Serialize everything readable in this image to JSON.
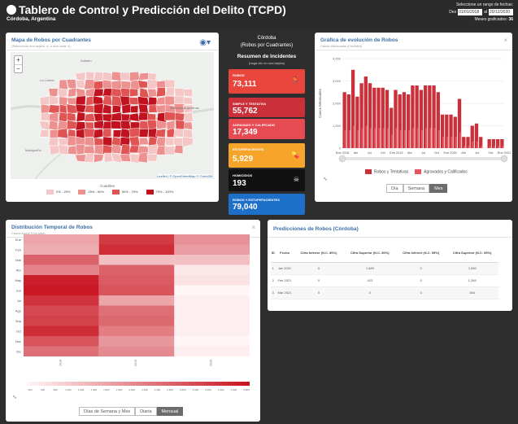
{
  "header": {
    "title": "Tablero de Control y Predicción del Delito (TCPD)",
    "subtitle": "Córdoba, Argentina",
    "date_prompt": "Seleccione un rango de fechas:",
    "date_from_label": "Des",
    "date_from": "01/01/2018",
    "date_to_label": "al",
    "date_to": "20/12/2020",
    "months_label": "Meses graficados:",
    "months_value": "36"
  },
  "map_card": {
    "title": "Mapa de Robos por Cuadrantes",
    "subtitle": "(Seleccione una región, ó, a una vista: 4)",
    "zoom_in": "+",
    "zoom_out": "−",
    "places": [
      "Kabalín",
      "La Calera",
      "Malagueño",
      "Malvinas Argentinas"
    ],
    "attribution": "Leaflet | © OpenStreetMap © CartoDB",
    "legend_title": "Cuartiles",
    "legend": [
      {
        "label": "0% - 25%",
        "color": "#f5c6c6"
      },
      {
        "label": "25% - 50%",
        "color": "#ec9090"
      },
      {
        "label": "50% - 75%",
        "color": "#e05454"
      },
      {
        "label": "75% - 100%",
        "color": "#c1121f"
      }
    ]
  },
  "center": {
    "city": "Córdoba",
    "city_sub": "(Robos por Cuadrantes)",
    "summary_title": "Resumen de Incidentes",
    "summary_sub": "(haga clic en una tarjeta)",
    "kpis": [
      {
        "label": "ROBOS",
        "value": "73,111",
        "color": "#e8453c",
        "icon": "🏃"
      },
      {
        "label": "SIMPLE Y TENTATIVA",
        "value": "55,762",
        "color": "#c9303a",
        "icon": ""
      },
      {
        "label": "AGRAVADO Y CALIFICADO",
        "value": "17,349",
        "color": "#e64a53",
        "icon": ""
      },
      {
        "label": "ESTUPEFACIENTES",
        "value": "5,929",
        "color": "#f7a42a",
        "icon": "💊"
      },
      {
        "label": "HOMICIDIOS",
        "value": "193",
        "color": "#111111",
        "icon": "☠"
      },
      {
        "label": "ROBOS Y ESTUPEFACIENTES",
        "value": "79,040",
        "color": "#1e6fc8",
        "icon": ""
      }
    ]
  },
  "evolution_card": {
    "title": "Gráfica de evolución de Robos",
    "subtitle": "Casos Mensuales (Córdoba)",
    "ylabel": "Casos Mensuales",
    "legend": [
      {
        "label": "Robos y Tentativas",
        "color": "#c9303a"
      },
      {
        "label": "Agravados y Calificados",
        "color": "#e85562"
      }
    ],
    "buttons": [
      "Día",
      "Semana",
      "Mes"
    ],
    "active_button": "Mes"
  },
  "heatmap_card": {
    "title": "Distribución Temporal de Robos",
    "subtitle": "Casos Anual (Córdoba)",
    "buttons": [
      "Días de Semana y Mes",
      "Diaria",
      "Mensual"
    ],
    "active_button": "Mensual",
    "rows": [
      "Ene",
      "Feb",
      "Mar",
      "Abr",
      "May",
      "Jun",
      "Jul",
      "Ago",
      "Sep",
      "Oct",
      "Nov",
      "Dic"
    ],
    "cols": [
      "2018",
      "2019",
      "2020"
    ],
    "scale_ticks": [
      "400",
      "600",
      "800",
      "1,000",
      "1,200",
      "1,400",
      "1,600",
      "1,800",
      "2,000",
      "2,200",
      "2,400",
      "2,600",
      "2,800",
      "3,000",
      "3,200",
      "3,400",
      "3,600",
      "3,800"
    ]
  },
  "prediction_card": {
    "title": "Predicciones de Robos (Córdoba)",
    "columns": [
      "ID",
      "Fecha",
      "Cifra Inferior (N.C. 80%)",
      "Cifra Superior (N.C. 80%)",
      "Cifra Inferior (N.C. 95%)",
      "Cifra Superior (N.C. 95%)"
    ],
    "rows": [
      [
        "1",
        "Jan 2021",
        "0",
        "1,689",
        "0",
        "2,536"
      ],
      [
        "2",
        "Feb 2021",
        "0",
        "423",
        "0",
        "1,265"
      ],
      [
        "3",
        "Mar 2021",
        "0",
        "0",
        "0",
        "364"
      ]
    ]
  },
  "chart_data": [
    {
      "type": "bar",
      "title": "Gráfica de evolución de Robos",
      "ylabel": "Casos Mensuales",
      "ylim": [
        0,
        4000
      ],
      "yticks": [
        "0",
        "1,000",
        "2,000",
        "3,000",
        "4,000"
      ],
      "xticks": [
        "Ene 2018",
        "Abr",
        "Jul",
        "Oct",
        "Ene 2019",
        "Abr",
        "Jul",
        "Oct",
        "Ene 2020",
        "Abr",
        "Jul",
        "Oct",
        "Ene 2021"
      ],
      "series": [
        {
          "name": "Robos y Tentativas",
          "values": [
            2500,
            2400,
            3500,
            2300,
            2900,
            3200,
            2900,
            2700,
            2700,
            2700,
            2600,
            1800,
            2600,
            2400,
            2500,
            2400,
            2800,
            2800,
            2600,
            2800,
            2800,
            2800,
            2500,
            1500,
            1500,
            1500,
            1400,
            2200,
            500,
            500,
            1000,
            1100,
            500,
            0,
            400,
            400,
            400,
            400
          ]
        },
        {
          "name": "Agravados y Calificados",
          "values": [
            800,
            800,
            1000,
            800,
            900,
            1000,
            900,
            900,
            900,
            900,
            900,
            600,
            900,
            800,
            800,
            800,
            900,
            900,
            800,
            900,
            900,
            900,
            800,
            500,
            500,
            500,
            500,
            700,
            100,
            100,
            300,
            300,
            100,
            0,
            100,
            100,
            100,
            100
          ]
        }
      ]
    },
    {
      "type": "heatmap",
      "title": "Distribución Temporal de Robos",
      "rows": [
        "Ene",
        "Feb",
        "Mar",
        "Abr",
        "May",
        "Jun",
        "Jul",
        "Ago",
        "Sep",
        "Oct",
        "Nov",
        "Dic"
      ],
      "cols": [
        "2018",
        "2019",
        "2020"
      ],
      "range": [
        400,
        3800
      ],
      "values": [
        [
          1600,
          3200,
          1900
        ],
        [
          1500,
          3400,
          1700
        ],
        [
          2600,
          1200,
          1200
        ],
        [
          2100,
          2600,
          600
        ],
        [
          3600,
          2700,
          700
        ],
        [
          3700,
          2800,
          400
        ],
        [
          3300,
          1600,
          500
        ],
        [
          3000,
          2400,
          500
        ],
        [
          3100,
          2500,
          500
        ],
        [
          3400,
          2200,
          500
        ],
        [
          2800,
          1800,
          400
        ],
        [
          2400,
          2000,
          500
        ]
      ]
    }
  ]
}
